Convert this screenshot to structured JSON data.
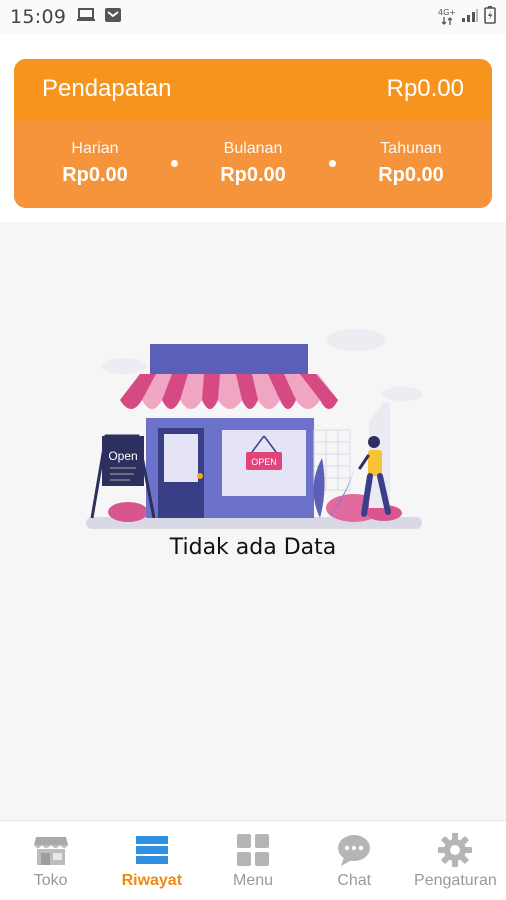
{
  "status_bar": {
    "time": "15:09",
    "network": "4G+"
  },
  "income": {
    "title": "Pendapatan",
    "total": "Rp0.00",
    "periods": [
      {
        "label": "Harian",
        "value": "Rp0.00"
      },
      {
        "label": "Bulanan",
        "value": "Rp0.00"
      },
      {
        "label": "Tahunan",
        "value": "Rp0.00"
      }
    ],
    "colors": {
      "header": "#f7941d",
      "body": "#f5943a"
    }
  },
  "empty_state": {
    "message": "Tidak ada Data",
    "illustration_open_sign": "Open",
    "illustration_open_banner": "OPEN"
  },
  "bottom_nav": {
    "active_index": 1,
    "active_color": "#f08a12",
    "items": [
      {
        "label": "Toko",
        "icon": "store-icon"
      },
      {
        "label": "Riwayat",
        "icon": "list-icon"
      },
      {
        "label": "Menu",
        "icon": "grid-icon"
      },
      {
        "label": "Chat",
        "icon": "chat-icon"
      },
      {
        "label": "Pengaturan",
        "icon": "gear-icon"
      }
    ]
  }
}
